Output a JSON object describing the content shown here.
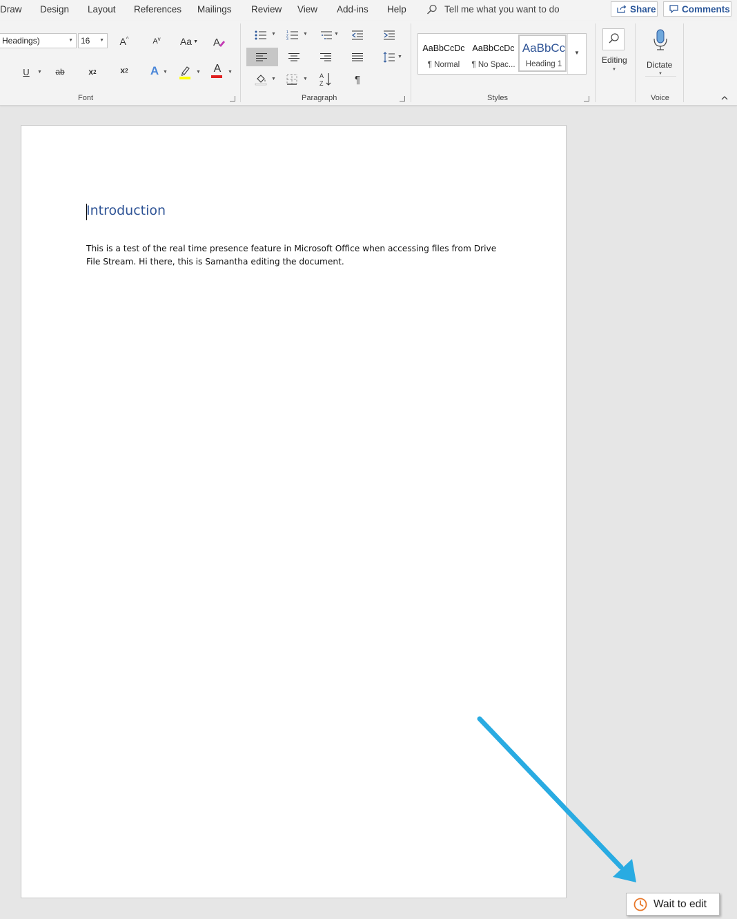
{
  "tabs": [
    "Draw",
    "Design",
    "Layout",
    "References",
    "Mailings",
    "Review",
    "View",
    "Add-ins",
    "Help"
  ],
  "tell_me": "Tell me what you want to do",
  "share_label": "Share",
  "comments_label": "Comments",
  "font": {
    "name": "Headings)",
    "size": "16",
    "group_label": "Font",
    "grow": "A",
    "shrink": "A",
    "case": "Aa",
    "underline": "U",
    "strike": "ab",
    "subscript": "x",
    "subscript_sub": "2",
    "superscript": "x",
    "superscript_sup": "2",
    "text_effects": "A",
    "font_color": "A",
    "highlight_color": "#ffff00",
    "font_color_value": "#e02020"
  },
  "paragraph": {
    "group_label": "Paragraph",
    "pilcrow": "¶"
  },
  "styles": {
    "group_label": "Styles",
    "items": [
      {
        "preview": "AaBbCcDc",
        "name": "¶ Normal"
      },
      {
        "preview": "AaBbCcDc",
        "name": "¶ No Spac..."
      },
      {
        "preview": "AaBbCc",
        "name": "Heading 1"
      }
    ]
  },
  "editing_label": "Editing",
  "dictate_label": "Dictate",
  "voice_group_label": "Voice",
  "document": {
    "heading": "Introduction",
    "body": "This is a test of the real time presence feature in Microsoft Office when accessing files from Drive File Stream. Hi there, this is Samantha editing the document."
  },
  "wait_button": "Wait to edit",
  "colors": {
    "accent": "#2b579a",
    "heading": "#2f5496",
    "arrow": "#29abe2",
    "clock": "#e8782a"
  }
}
